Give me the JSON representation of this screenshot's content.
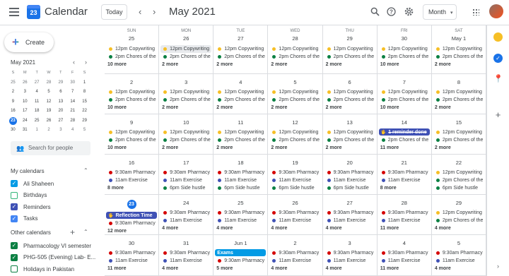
{
  "header": {
    "app_title": "Calendar",
    "logo_day": "23",
    "today_label": "Today",
    "prev_icon": "‹",
    "next_icon": "›",
    "month_label": "May 2021",
    "view_label": "Month",
    "view_caret": "▾"
  },
  "sidebar": {
    "create_label": "Create",
    "mini": {
      "title": "May 2021",
      "prev": "‹",
      "next": "›",
      "weekdays": [
        "S",
        "M",
        "T",
        "W",
        "T",
        "F",
        "S"
      ],
      "weeks": [
        [
          "25",
          "26",
          "27",
          "28",
          "29",
          "30",
          "1"
        ],
        [
          "2",
          "3",
          "4",
          "5",
          "6",
          "7",
          "8"
        ],
        [
          "9",
          "10",
          "11",
          "12",
          "13",
          "14",
          "15"
        ],
        [
          "16",
          "17",
          "18",
          "19",
          "20",
          "21",
          "22"
        ],
        [
          "23",
          "24",
          "25",
          "26",
          "27",
          "28",
          "29"
        ],
        [
          "30",
          "31",
          "1",
          "2",
          "3",
          "4",
          "5"
        ]
      ]
    },
    "search_placeholder": "Search for people",
    "my_title": "My calendars",
    "my_calendars": [
      {
        "label": "Ali Shaheen",
        "color": "#039be5",
        "checked": true
      },
      {
        "label": "Birthdays",
        "color": "#33b679",
        "checked": false
      },
      {
        "label": "Reminders",
        "color": "#3f51b5",
        "checked": true
      },
      {
        "label": "Tasks",
        "color": "#4285f4",
        "checked": true
      }
    ],
    "other_title": "Other calendars",
    "other_add": "+",
    "other_calendars": [
      {
        "label": "Pharmacology VI semester",
        "color": "#0b8043",
        "checked": true
      },
      {
        "label": "PHG-505 (Evening) Lab- E...",
        "color": "#0b8043",
        "checked": true
      },
      {
        "label": "Holidays in Pakistan",
        "color": "#0b8043",
        "checked": false
      }
    ]
  },
  "colors": {
    "yellow": "#f6bf26",
    "green": "#0b8043",
    "red": "#d50000",
    "navy": "#3f51b5",
    "indigo": "#3f51b5",
    "blue": "#039be5"
  },
  "weekdays": [
    "SUN",
    "MON",
    "TUE",
    "WED",
    "THU",
    "FRI",
    "SAT"
  ],
  "weeks": [
    [
      {
        "day": "25",
        "events": [
          {
            "c": "yellow",
            "t": "12pm Copywriting"
          },
          {
            "c": "green",
            "t": "2pm Chores of the"
          }
        ],
        "more": "10 more"
      },
      {
        "day": "26",
        "events": [
          {
            "c": "yellow",
            "t": "12pm Copywriting",
            "hl": true
          },
          {
            "c": "green",
            "t": "2pm Chores of the"
          }
        ],
        "more": "2 more"
      },
      {
        "day": "27",
        "events": [
          {
            "c": "yellow",
            "t": "12pm Copywriting"
          },
          {
            "c": "green",
            "t": "2pm Chores of the"
          }
        ],
        "more": "2 more"
      },
      {
        "day": "28",
        "events": [
          {
            "c": "yellow",
            "t": "12pm Copywriting"
          },
          {
            "c": "green",
            "t": "2pm Chores of the"
          }
        ],
        "more": "2 more"
      },
      {
        "day": "29",
        "events": [
          {
            "c": "yellow",
            "t": "12pm Copywriting"
          },
          {
            "c": "green",
            "t": "2pm Chores of the"
          }
        ],
        "more": "2 more"
      },
      {
        "day": "30",
        "events": [
          {
            "c": "yellow",
            "t": "12pm Copywriting"
          },
          {
            "c": "green",
            "t": "2pm Chores of the"
          }
        ],
        "more": "10 more"
      },
      {
        "day": "May 1",
        "events": [
          {
            "c": "yellow",
            "t": "12pm Copywriting"
          },
          {
            "c": "green",
            "t": "2pm Chores of the"
          }
        ],
        "more": "2 more"
      }
    ],
    [
      {
        "day": "2",
        "events": [
          {
            "c": "yellow",
            "t": "12pm Copywriting"
          },
          {
            "c": "green",
            "t": "2pm Chores of the"
          }
        ],
        "more": "10 more"
      },
      {
        "day": "3",
        "events": [
          {
            "c": "yellow",
            "t": "12pm Copywriting"
          },
          {
            "c": "green",
            "t": "2pm Chores of the"
          }
        ],
        "more": "2 more"
      },
      {
        "day": "4",
        "events": [
          {
            "c": "yellow",
            "t": "12pm Copywriting"
          },
          {
            "c": "green",
            "t": "2pm Chores of the"
          }
        ],
        "more": "2 more"
      },
      {
        "day": "5",
        "events": [
          {
            "c": "yellow",
            "t": "12pm Copywriting"
          },
          {
            "c": "green",
            "t": "2pm Chores of the"
          }
        ],
        "more": "2 more"
      },
      {
        "day": "6",
        "events": [
          {
            "c": "yellow",
            "t": "12pm Copywriting"
          },
          {
            "c": "green",
            "t": "2pm Chores of the"
          }
        ],
        "more": "2 more"
      },
      {
        "day": "7",
        "events": [
          {
            "c": "yellow",
            "t": "12pm Copywriting"
          },
          {
            "c": "green",
            "t": "2pm Chores of the"
          }
        ],
        "more": "10 more"
      },
      {
        "day": "8",
        "events": [
          {
            "c": "yellow",
            "t": "12pm Copywriting"
          },
          {
            "c": "green",
            "t": "2pm Chores of the"
          }
        ],
        "more": "2 more"
      }
    ],
    [
      {
        "day": "9",
        "events": [
          {
            "c": "yellow",
            "t": "12pm Copywriting"
          },
          {
            "c": "green",
            "t": "2pm Chores of the"
          }
        ],
        "more": "10 more"
      },
      {
        "day": "10",
        "events": [
          {
            "c": "yellow",
            "t": "12pm Copywriting"
          },
          {
            "c": "green",
            "t": "2pm Chores of the"
          }
        ],
        "more": "2 more"
      },
      {
        "day": "11",
        "events": [
          {
            "c": "yellow",
            "t": "12pm Copywriting"
          },
          {
            "c": "green",
            "t": "2pm Chores of the"
          }
        ],
        "more": "2 more"
      },
      {
        "day": "12",
        "events": [
          {
            "c": "yellow",
            "t": "12pm Copywriting"
          },
          {
            "c": "green",
            "t": "2pm Chores of the"
          }
        ],
        "more": "2 more"
      },
      {
        "day": "13",
        "events": [
          {
            "c": "yellow",
            "t": "12pm Copywriting"
          },
          {
            "c": "green",
            "t": "2pm Chores of the"
          }
        ],
        "more": "2 more"
      },
      {
        "day": "14",
        "events": [
          {
            "c": "navy",
            "t": "1 reminder done",
            "block": true,
            "strike": true,
            "icon": "🖐"
          },
          {
            "c": "green",
            "t": "2pm Chores of the"
          }
        ],
        "more": "11 more"
      },
      {
        "day": "15",
        "events": [
          {
            "c": "yellow",
            "t": "12pm Copywriting"
          },
          {
            "c": "green",
            "t": "2pm Chores of the"
          }
        ],
        "more": "2 more"
      }
    ],
    [
      {
        "day": "16",
        "events": [
          {
            "c": "red",
            "t": "9:30am Pharmacy"
          },
          {
            "c": "indigo",
            "t": "11am Exercise"
          }
        ],
        "more": "8 more"
      },
      {
        "day": "17",
        "events": [
          {
            "c": "red",
            "t": "9:30am Pharmacy"
          },
          {
            "c": "indigo",
            "t": "11am Exercise"
          },
          {
            "c": "green",
            "t": "6pm Side hustle"
          }
        ],
        "more": ""
      },
      {
        "day": "18",
        "events": [
          {
            "c": "red",
            "t": "9:30am Pharmacy"
          },
          {
            "c": "indigo",
            "t": "11am Exercise"
          },
          {
            "c": "green",
            "t": "6pm Side hustle"
          }
        ],
        "more": ""
      },
      {
        "day": "19",
        "events": [
          {
            "c": "red",
            "t": "9:30am Pharmacy"
          },
          {
            "c": "indigo",
            "t": "11am Exercise"
          },
          {
            "c": "green",
            "t": "6pm Side hustle"
          }
        ],
        "more": ""
      },
      {
        "day": "20",
        "events": [
          {
            "c": "red",
            "t": "9:30am Pharmacy"
          },
          {
            "c": "indigo",
            "t": "11am Exercise"
          },
          {
            "c": "green",
            "t": "6pm Side hustle"
          }
        ],
        "more": ""
      },
      {
        "day": "21",
        "events": [
          {
            "c": "red",
            "t": "9:30am Pharmacy"
          },
          {
            "c": "indigo",
            "t": "11am Exercise"
          }
        ],
        "more": "8 more"
      },
      {
        "day": "22",
        "events": [
          {
            "c": "yellow",
            "t": "12pm Copywriting"
          },
          {
            "c": "green",
            "t": "2pm Chores of the"
          },
          {
            "c": "green",
            "t": "6pm Side hustle"
          }
        ],
        "more": ""
      }
    ],
    [
      {
        "day": "23",
        "today": true,
        "events": [
          {
            "c": "navy",
            "t": "Reflection Time",
            "block": true,
            "icon": "🖐"
          },
          {
            "c": "red",
            "t": "9:30am Pharmacy"
          }
        ],
        "more": "12 more"
      },
      {
        "day": "24",
        "events": [
          {
            "c": "red",
            "t": "9:30am Pharmacy"
          },
          {
            "c": "indigo",
            "t": "11am Exercise"
          }
        ],
        "more": "4 more"
      },
      {
        "day": "25",
        "events": [
          {
            "c": "red",
            "t": "9:30am Pharmacy"
          },
          {
            "c": "indigo",
            "t": "11am Exercise"
          }
        ],
        "more": "4 more"
      },
      {
        "day": "26",
        "events": [
          {
            "c": "red",
            "t": "9:30am Pharmacy"
          },
          {
            "c": "indigo",
            "t": "11am Exercise"
          }
        ],
        "more": "4 more"
      },
      {
        "day": "27",
        "events": [
          {
            "c": "red",
            "t": "9:30am Pharmacy"
          },
          {
            "c": "indigo",
            "t": "11am Exercise"
          }
        ],
        "more": "4 more"
      },
      {
        "day": "28",
        "events": [
          {
            "c": "red",
            "t": "9:30am Pharmacy"
          },
          {
            "c": "indigo",
            "t": "11am Exercise"
          }
        ],
        "more": "11 more"
      },
      {
        "day": "29",
        "events": [
          {
            "c": "yellow",
            "t": "12pm Copywriting"
          },
          {
            "c": "green",
            "t": "2pm Chores of the"
          }
        ],
        "more": "4 more"
      }
    ],
    [
      {
        "day": "30",
        "events": [
          {
            "c": "red",
            "t": "9:30am Pharmacy"
          },
          {
            "c": "indigo",
            "t": "11am Exercise"
          }
        ],
        "more": "11 more"
      },
      {
        "day": "31",
        "events": [
          {
            "c": "red",
            "t": "9:30am Pharmacy"
          },
          {
            "c": "indigo",
            "t": "11am Exercise"
          }
        ],
        "more": "4 more"
      },
      {
        "day": "Jun 1",
        "events": [
          {
            "c": "blue",
            "t": "Exams",
            "block": true
          },
          {
            "c": "red",
            "t": "9:30am Pharmacy"
          }
        ],
        "more": "5 more"
      },
      {
        "day": "2",
        "events": [
          {
            "c": "red",
            "t": "9:30am Pharmacy"
          },
          {
            "c": "indigo",
            "t": "11am Exercise"
          }
        ],
        "more": "4 more"
      },
      {
        "day": "3",
        "events": [
          {
            "c": "red",
            "t": "9:30am Pharmacy"
          },
          {
            "c": "indigo",
            "t": "11am Exercise"
          }
        ],
        "more": "4 more"
      },
      {
        "day": "4",
        "events": [
          {
            "c": "red",
            "t": "9:30am Pharmacy"
          },
          {
            "c": "indigo",
            "t": "11am Exercise"
          }
        ],
        "more": "11 more"
      },
      {
        "day": "5",
        "events": [
          {
            "c": "red",
            "t": "9:30am Pharmacy"
          },
          {
            "c": "indigo",
            "t": "11am Exercise"
          }
        ],
        "more": "4 more"
      }
    ]
  ]
}
